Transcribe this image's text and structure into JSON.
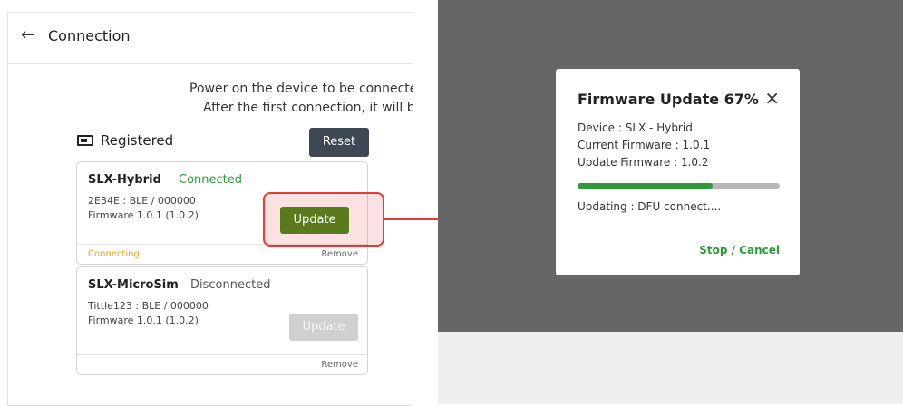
{
  "phone": {
    "header_back": "←",
    "title": "Connection",
    "intro_line1": "Power on the device to be connecte",
    "intro_line2": "After the first connection, it will be",
    "registered_label": "Registered",
    "reset_label": "Reset",
    "devices": [
      {
        "name": "SLX-Hybrid",
        "status": "Connected",
        "line1": "2E34E : BLE / 000000",
        "line2": "Firmware 1.0.1 (1.0.2)",
        "update_label": "Update",
        "foot_left": "Connecting",
        "foot_right": "Remove"
      },
      {
        "name": "SLX-MicroSim",
        "status": "Disconnected",
        "line1": "Tittle123 : BLE / 000000",
        "line2": "Firmware 1.0.1 (1.0.2)",
        "update_label": "Update",
        "foot_right": "Remove"
      }
    ]
  },
  "dialog": {
    "title": "Firmware Update 67%",
    "close": "×",
    "device": "Device : SLX - Hybrid",
    "current": "Current Firmware : 1.0.1",
    "update": "Update Firmware : 1.0.2",
    "progress": 0.67,
    "status": "Updating : DFU connect....",
    "stop_label": "Stop / Cancel"
  },
  "colors": {
    "accent_green": "#2e9a3a",
    "update_button": "#5a7a1e",
    "highlight_red": "#e53935",
    "connecting_orange": "#e5a41e"
  }
}
